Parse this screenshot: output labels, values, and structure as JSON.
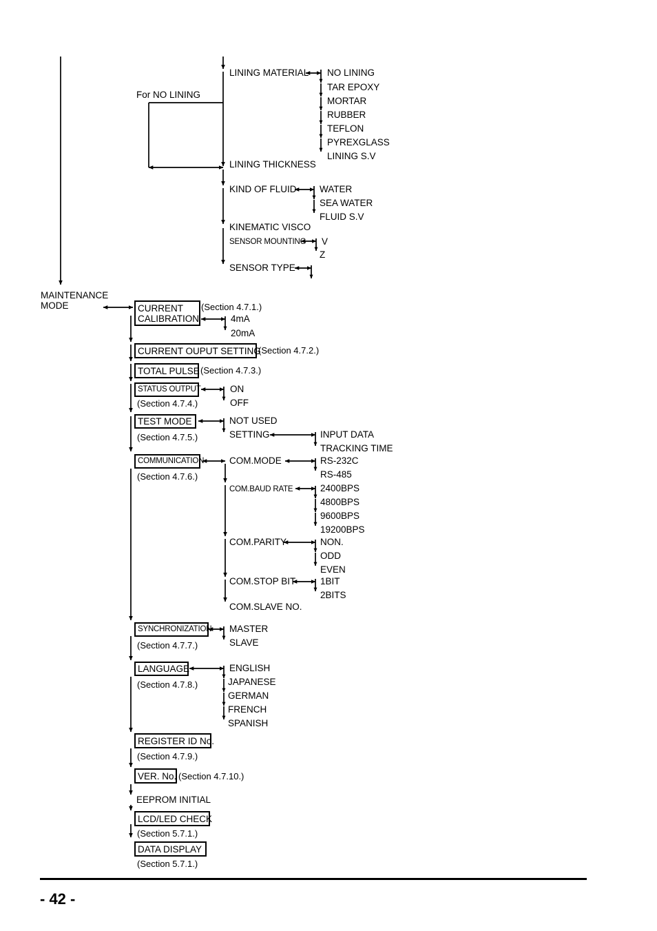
{
  "page": {
    "number": "- 42 -",
    "title": "Maintenance Mode Menu Flow Diagram"
  },
  "top_flow": {
    "note_for_no_lining": "For NO LINING",
    "items": [
      {
        "label": "LINING MATERIAL",
        "options": [
          "NO LINING",
          "TAR EPOXY",
          "MORTAR",
          "RUBBER",
          "TEFLON",
          "PYREXGLASS",
          "LINING S.V"
        ]
      },
      {
        "label": "LINING THICKNESS",
        "options": []
      },
      {
        "label": "KIND OF FLUID",
        "options": [
          "WATER",
          "SEA WATER",
          "FLUID S.V"
        ]
      },
      {
        "label": "KINEMATIC VISCO",
        "options": []
      },
      {
        "label": "SENSOR MOUNTING",
        "options": [
          "V",
          "Z"
        ]
      },
      {
        "label": "SENSOR TYPE",
        "options": []
      }
    ]
  },
  "maintenance": {
    "label_line1": "MAINTENANCE",
    "label_line2": "MODE",
    "entries": [
      {
        "box_line1": "CURRENT",
        "box_line2": "CALIBRATION",
        "section": "(Section 4.7.1.)",
        "options": [
          "4mA",
          "20mA"
        ]
      },
      {
        "box_line1": "CURRENT OUPUT SETTING",
        "section": "(Section 4.7.2.)",
        "options": []
      },
      {
        "box_line1": "TOTAL PULSE",
        "section": "(Section 4.7.3.)",
        "options": []
      },
      {
        "box_line1": "STATUS OUTPUT",
        "section": "(Section 4.7.4.)",
        "options": [
          "ON",
          "OFF"
        ]
      },
      {
        "box_line1": "TEST MODE",
        "section": "(Section 4.7.5.)",
        "options": [
          "NOT USED",
          "SETTING"
        ],
        "sub_options": [
          "INPUT DATA",
          "TRACKING TIME"
        ]
      },
      {
        "box_line1": "COMMUNICATION",
        "section": "(Section 4.7.6.)",
        "params": [
          {
            "label": "COM.MODE",
            "options": [
              "RS-232C",
              "RS-485"
            ]
          },
          {
            "label": "COM.BAUD RATE",
            "options": [
              "2400BPS",
              "4800BPS",
              "9600BPS",
              "19200BPS"
            ]
          },
          {
            "label": "COM.PARITY",
            "options": [
              "NON.",
              "ODD",
              "EVEN"
            ]
          },
          {
            "label": "COM.STOP BIT",
            "options": [
              "1BIT",
              "2BITS"
            ]
          },
          {
            "label": "COM.SLAVE NO.",
            "options": []
          }
        ]
      },
      {
        "box_line1": "SYNCHRONIZATION",
        "section": "(Section 4.7.7.)",
        "options": [
          "MASTER",
          "SLAVE"
        ]
      },
      {
        "box_line1": "LANGUAGE",
        "section": "(Section 4.7.8.)",
        "options": [
          "ENGLISH",
          "JAPANESE",
          "GERMAN",
          "FRENCH",
          "SPANISH"
        ]
      },
      {
        "box_line1": "REGISTER ID No.",
        "section": "(Section 4.7.9.)",
        "options": []
      },
      {
        "box_line1": "VER. No.",
        "section": "(Section 4.7.10.)",
        "options": []
      },
      {
        "box_line1": "EEPROM INITIAL",
        "section": "",
        "options": [],
        "boxed": false
      },
      {
        "box_line1": "LCD/LED CHECK",
        "section": "(Section 5.7.1.)",
        "options": []
      },
      {
        "box_line1": "DATA DISPLAY",
        "section": "(Section 5.7.1.)",
        "options": []
      }
    ]
  }
}
